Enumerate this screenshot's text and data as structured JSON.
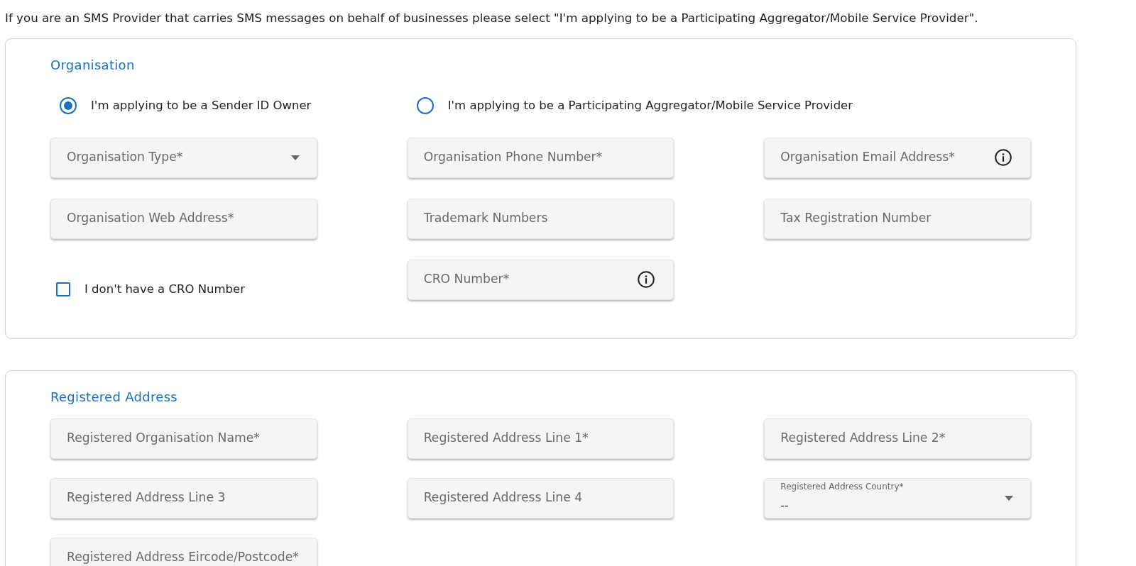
{
  "intro": "If you are an SMS Provider that carries SMS messages on behalf of businesses please select \"I'm applying to be a Participating Aggregator/Mobile Service Provider\".",
  "sections": [
    {
      "title": "Organisation",
      "applicant_types": [
        {
          "label": "I'm applying to be a Sender ID Owner",
          "selected": true
        },
        {
          "label": "I'm applying to be a Participating Aggregator/Mobile Service Provider",
          "selected": false
        }
      ],
      "fields": [
        {
          "kind": "select",
          "placeholder": "Organisation Type*"
        },
        {
          "kind": "input",
          "placeholder": "Organisation Phone Number*",
          "info": false
        },
        {
          "kind": "input",
          "placeholder": "Organisation Email Address*",
          "info": true
        },
        {
          "kind": "input",
          "placeholder": "Organisation Web Address*",
          "info": false
        },
        {
          "kind": "input",
          "placeholder": "Trademark Numbers",
          "info": false
        },
        {
          "kind": "input",
          "placeholder": "Tax Registration Number",
          "info": false
        },
        {
          "kind": "checkbox",
          "label": "I don't have a CRO Number",
          "checked": false
        },
        {
          "kind": "input",
          "placeholder": "CRO Number*",
          "info": true
        }
      ]
    },
    {
      "title": "Registered Address",
      "fields": [
        {
          "kind": "input",
          "placeholder": "Registered Organisation Name*",
          "info": false
        },
        {
          "kind": "input",
          "placeholder": "Registered Address Line 1*",
          "info": false
        },
        {
          "kind": "input",
          "placeholder": "Registered Address Line 2*",
          "info": false
        },
        {
          "kind": "input",
          "placeholder": "Registered Address Line 3",
          "info": false
        },
        {
          "kind": "input",
          "placeholder": "Registered Address Line 4",
          "info": false
        },
        {
          "kind": "select",
          "label": "Registered Address Country*",
          "value": "--"
        },
        {
          "kind": "input",
          "placeholder": "Registered Address Eircode/Postcode*",
          "info": false
        }
      ]
    }
  ]
}
